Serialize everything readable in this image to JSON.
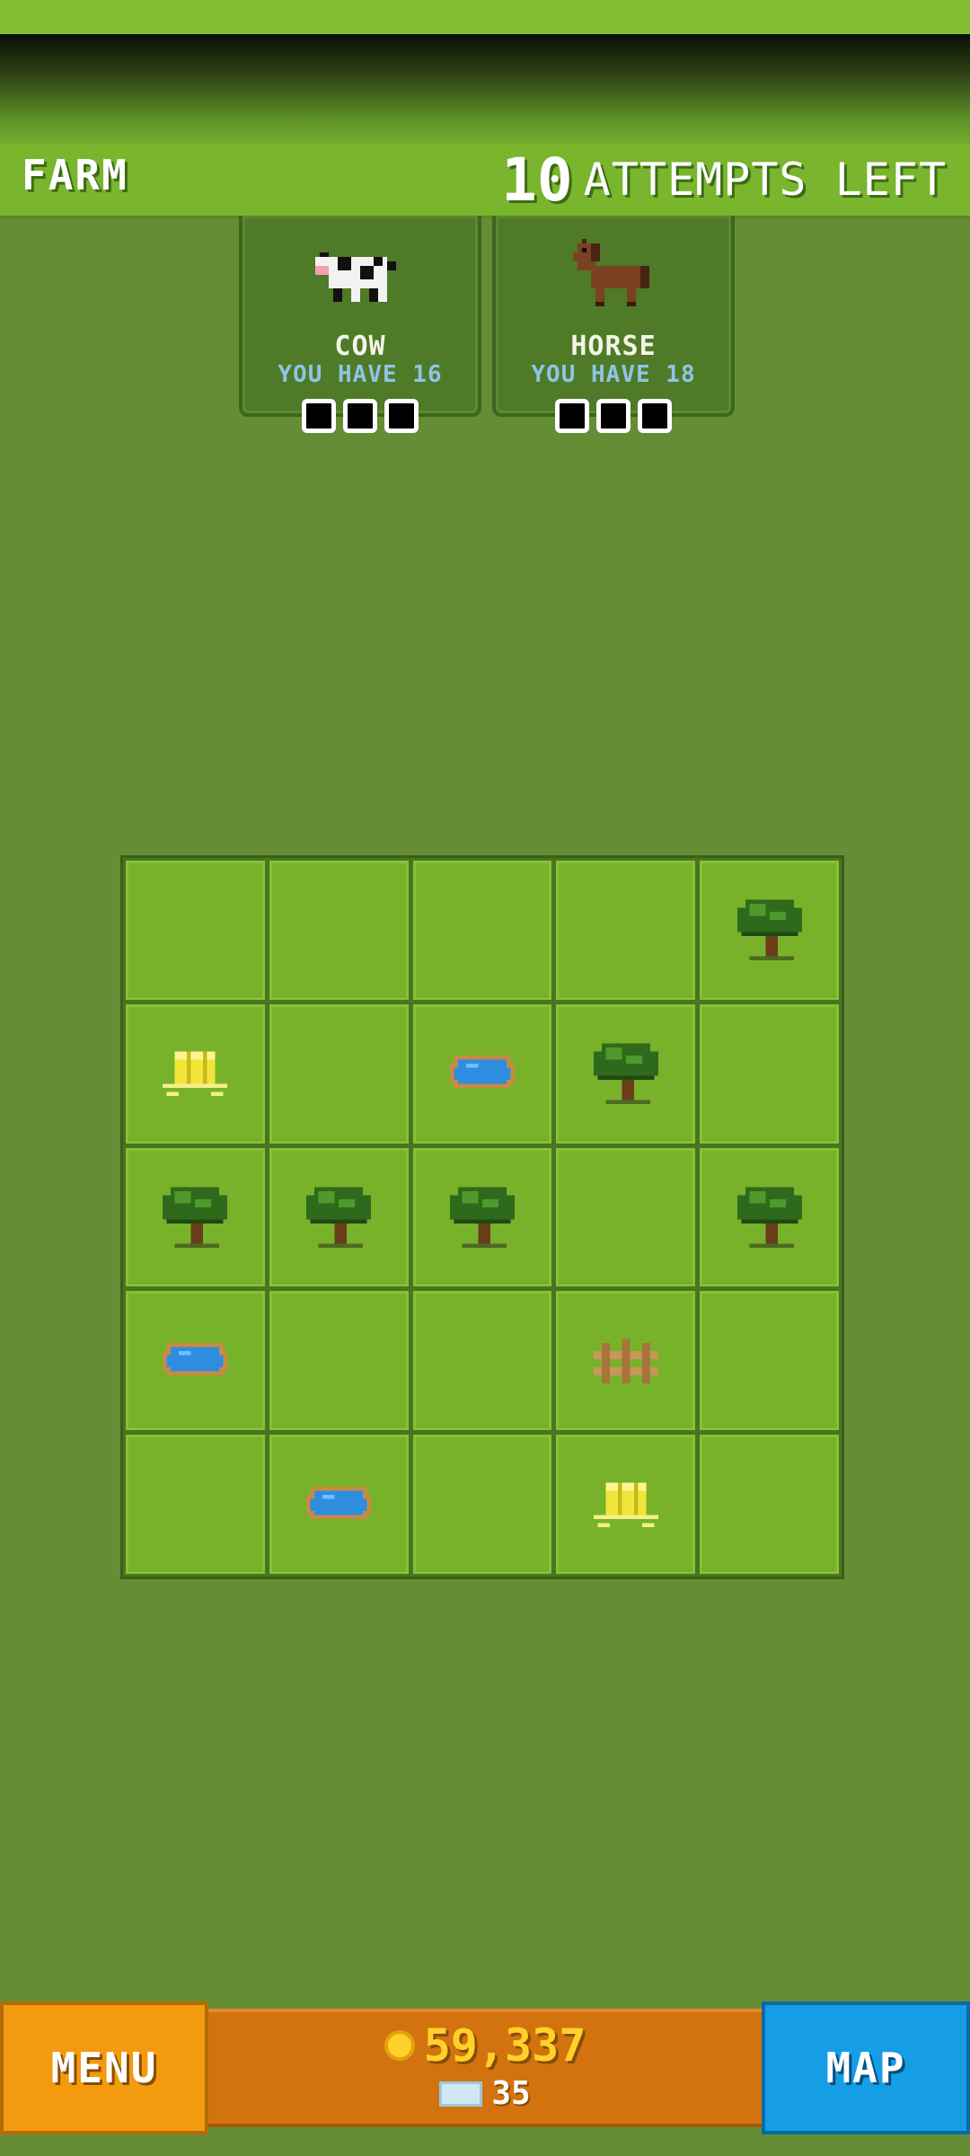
{
  "header": {
    "level_name": "FARM",
    "attempts_number": "10",
    "attempts_label": "ATTEMPTS LEFT"
  },
  "animals": [
    {
      "name": "COW",
      "count_text": "YOU HAVE 16",
      "icon": "cow-icon",
      "slots_filled": 0,
      "slots_total": 3
    },
    {
      "name": "HORSE",
      "count_text": "YOU HAVE 18",
      "icon": "horse-icon",
      "slots_filled": 0,
      "slots_total": 3
    }
  ],
  "board": {
    "rows": [
      [
        "grass",
        "grass",
        "grass",
        "grass",
        "tree"
      ],
      [
        "hay",
        "grass",
        "pond",
        "tree",
        "grass"
      ],
      [
        "tree",
        "tree",
        "tree",
        "grass",
        "tree"
      ],
      [
        "pond",
        "grass",
        "grass",
        "fence",
        "grass"
      ],
      [
        "grass",
        "pond",
        "grass",
        "hay",
        "grass"
      ]
    ]
  },
  "footer": {
    "menu_label": "MENU",
    "map_label": "MAP",
    "coins": "59,337",
    "tickets": "35"
  },
  "colors": {
    "background": "#658d36",
    "tile": "#77b22a",
    "menu_button": "#f39a0f",
    "map_button": "#159ee6",
    "wallet": "#d27310",
    "coin_text": "#ffd12a"
  }
}
